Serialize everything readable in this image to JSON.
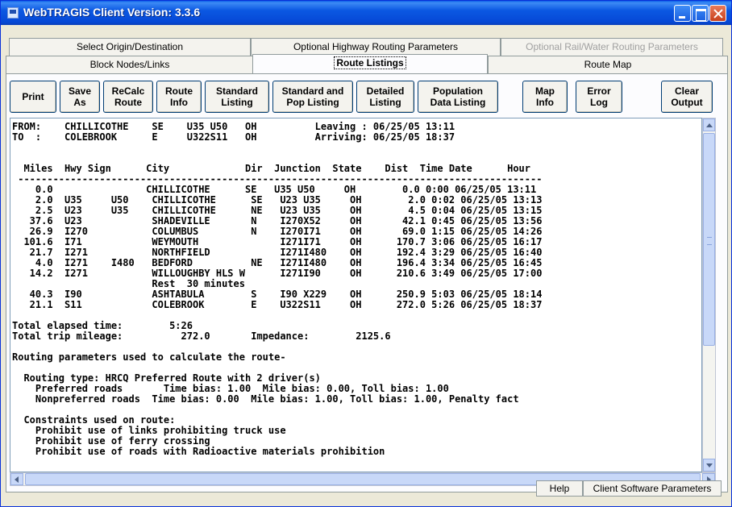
{
  "window": {
    "title": "WebTRAGIS Client Version: 3.3.6"
  },
  "tabs_row1": [
    {
      "label": "Select Origin/Destination",
      "disabled": false
    },
    {
      "label": "Optional Highway Routing Parameters",
      "disabled": false
    },
    {
      "label": "Optional Rail/Water Routing Parameters",
      "disabled": true
    }
  ],
  "tabs_row2": [
    {
      "label": "Block Nodes/Links"
    },
    {
      "label": "Route Listings",
      "active": true
    },
    {
      "label": "Route Map"
    }
  ],
  "toolbar": {
    "print": "Print",
    "save_l1": "Save",
    "save_l2": "As",
    "recalc_l1": "ReCalc",
    "recalc_l2": "Route",
    "route_info_l1": "Route",
    "route_info_l2": "Info",
    "standard_l1": "Standard",
    "standard_l2": "Listing",
    "stdpop_l1": "Standard and",
    "stdpop_l2": "Pop Listing",
    "detailed_l1": "Detailed",
    "detailed_l2": "Listing",
    "population_l1": "Population",
    "population_l2": "Data Listing",
    "mapinfo_l1": "Map",
    "mapinfo_l2": "Info",
    "errorlog_l1": "Error",
    "errorlog_l2": "Log",
    "clear_l1": "Clear",
    "clear_l2": "Output"
  },
  "output": {
    "lines": [
      "FROM:    CHILLICOTHE    SE    U35 U50   OH          Leaving : 06/25/05 13:11",
      "TO  :    COLEBROOK      E     U322S11   OH          Arriving: 06/25/05 18:37",
      "",
      "",
      "  Miles  Hwy Sign      City             Dir  Junction  State    Dist  Time Date      Hour",
      " ------------------------------------------------------------------------------------------",
      "    0.0                CHILLICOTHE      SE   U35 U50     OH        0.0 0:00 06/25/05 13:11",
      "    2.0  U35     U50    CHILLICOTHE      SE   U23 U35     OH        2.0 0:02 06/25/05 13:13",
      "    2.5  U23     U35    CHILLICOTHE      NE   U23 U35     OH        4.5 0:04 06/25/05 13:15",
      "   37.6  U23            SHADEVILLE       N    I270X52     OH       42.1 0:45 06/25/05 13:56",
      "   26.9  I270           COLUMBUS         N    I270I71     OH       69.0 1:15 06/25/05 14:26",
      "  101.6  I71            WEYMOUTH              I271I71     OH      170.7 3:06 06/25/05 16:17",
      "   21.7  I271           NORTHFIELD            I271I480    OH      192.4 3:29 06/25/05 16:40",
      "    4.0  I271    I480   BEDFORD          NE   I271I480    OH      196.4 3:34 06/25/05 16:45",
      "   14.2  I271           WILLOUGHBY HLS W      I271I90     OH      210.6 3:49 06/25/05 17:00",
      "                        Rest  30 minutes",
      "   40.3  I90            ASHTABULA        S    I90 X229    OH      250.9 5:03 06/25/05 18:14",
      "   21.1  S11            COLEBROOK        E    U322S11     OH      272.0 5:26 06/25/05 18:37",
      "",
      "Total elapsed time:        5:26",
      "Total trip mileage:          272.0       Impedance:        2125.6",
      "",
      "Routing parameters used to calculate the route-",
      "",
      "  Routing type: HRCQ Preferred Route with 2 driver(s)",
      "    Preferred roads       Time bias: 1.00  Mile bias: 0.00, Toll bias: 1.00",
      "    Nonpreferred roads  Time bias: 0.00  Mile bias: 1.00, Toll bias: 1.00, Penalty fact",
      "",
      "  Constraints used on route:",
      "    Prohibit use of links prohibiting truck use",
      "    Prohibit use of ferry crossing",
      "    Prohibit use of roads with Radioactive materials prohibition"
    ]
  },
  "status": {
    "help": "Help",
    "client_params": "Client Software Parameters"
  }
}
